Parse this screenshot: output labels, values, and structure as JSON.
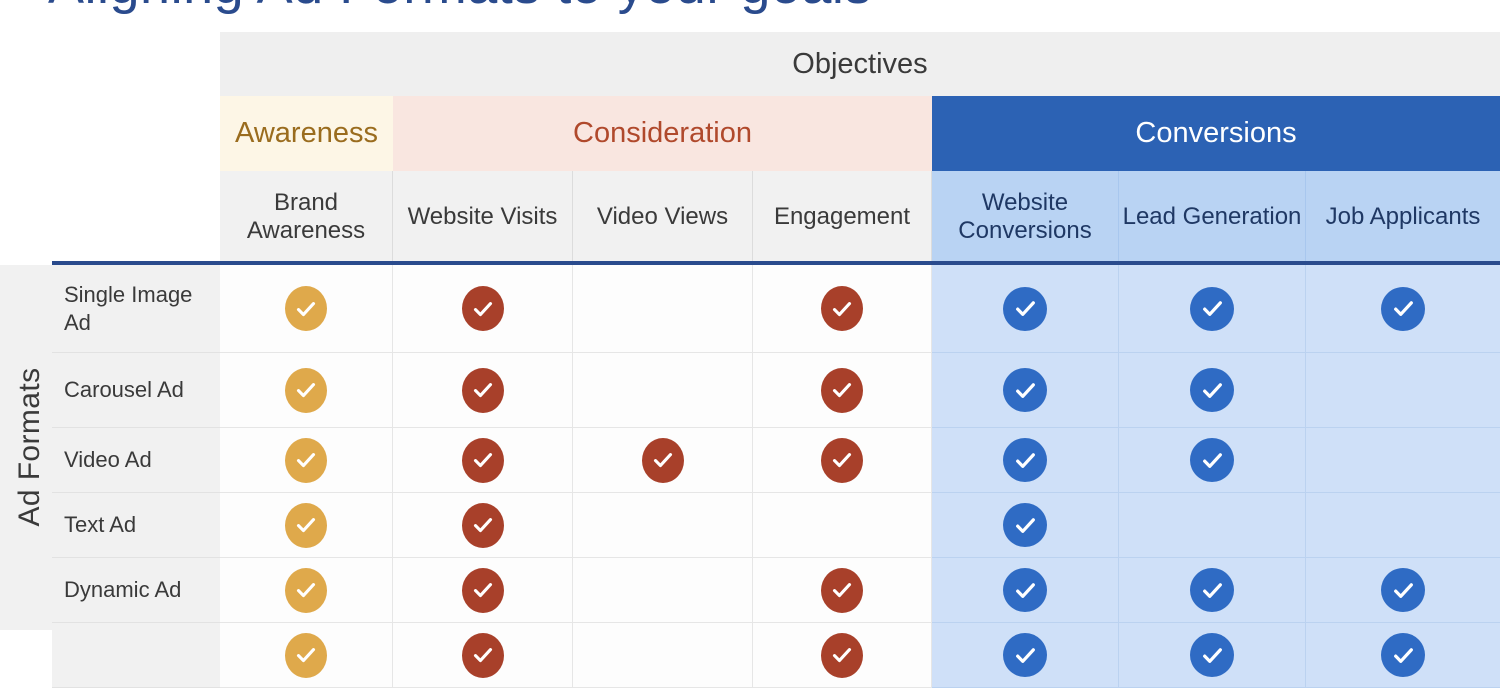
{
  "title": "Aligning Ad Formats to your goals",
  "axis": {
    "rows_caption": "Ad Formats",
    "cols_caption": "Objectives"
  },
  "colors": {
    "title": "#2A4B8D",
    "awareness_band_bg": "#FDF6E6",
    "awareness_band_text": "#9A6C1E",
    "consideration_band_bg": "#F9E6E0",
    "consideration_band_text": "#B0492C",
    "conversions_band_bg": "#2C62B4",
    "conversions_band_text": "#FFFFFF",
    "conversions_sub_bg": "#B9D3F3",
    "conversions_cell_bg": "#CFE0F8",
    "check_awareness": "#DFA94B",
    "check_consideration": "#A8402A",
    "check_conversions": "#2F6BC4",
    "objectives_band_bg": "#EFEFEF",
    "underline": "#2A4B8D"
  },
  "groups": [
    {
      "label": "Awareness",
      "span": 1
    },
    {
      "label": "Consideration",
      "span": 3
    },
    {
      "label": "Conversions",
      "span": 3
    }
  ],
  "columns": [
    {
      "label": "Brand Awareness",
      "group": "Awareness",
      "tone": "awareness"
    },
    {
      "label": "Website Visits",
      "group": "Consideration",
      "tone": "consideration"
    },
    {
      "label": "Video Views",
      "group": "Consideration",
      "tone": "consideration"
    },
    {
      "label": "Engagement",
      "group": "Consideration",
      "tone": "consideration"
    },
    {
      "label": "Website Conversions",
      "group": "Conversions",
      "tone": "conversions"
    },
    {
      "label": "Lead Generation",
      "group": "Conversions",
      "tone": "conversions"
    },
    {
      "label": "Job Applicants",
      "group": "Conversions",
      "tone": "conversions"
    }
  ],
  "rows": [
    {
      "label": "Single Image Ad",
      "checks": [
        true,
        true,
        false,
        true,
        true,
        true,
        true
      ]
    },
    {
      "label": "Carousel Ad",
      "checks": [
        true,
        true,
        false,
        true,
        true,
        true,
        false
      ]
    },
    {
      "label": "Video Ad",
      "checks": [
        true,
        true,
        true,
        true,
        true,
        true,
        false
      ]
    },
    {
      "label": "Text Ad",
      "checks": [
        true,
        true,
        false,
        false,
        true,
        false,
        false
      ]
    },
    {
      "label": "Dynamic Ad",
      "checks": [
        true,
        true,
        false,
        true,
        true,
        true,
        true
      ]
    },
    {
      "label": "",
      "checks": [
        true,
        true,
        false,
        true,
        true,
        true,
        true
      ]
    }
  ],
  "icons": {
    "check": "check-circle-icon"
  }
}
